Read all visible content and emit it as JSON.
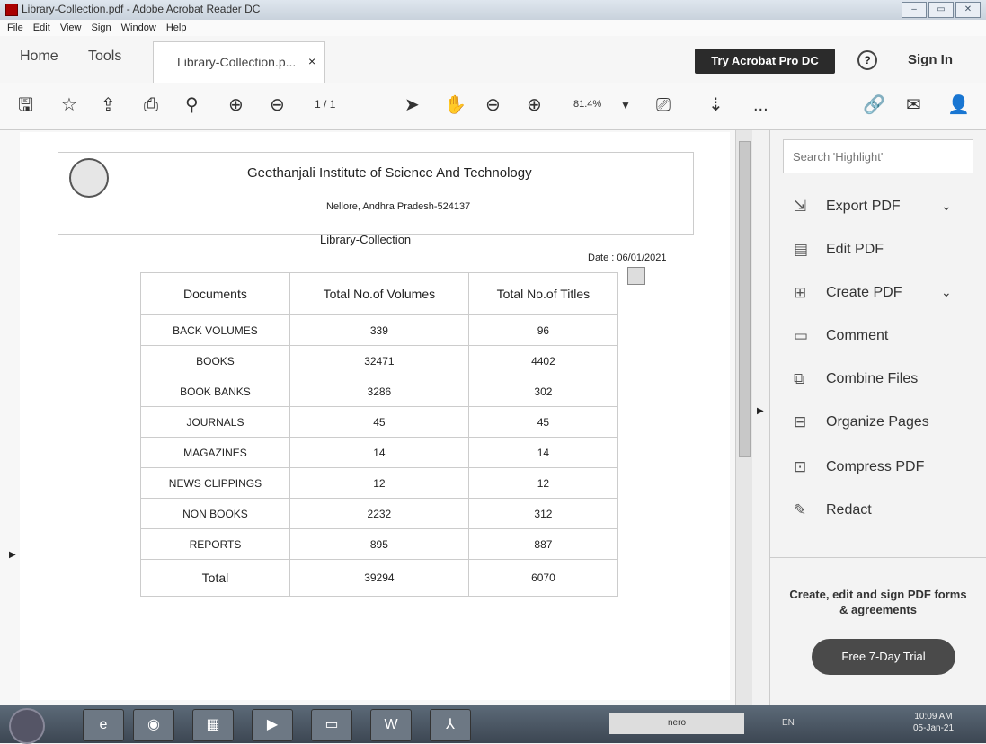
{
  "window": {
    "title": "Library-Collection.pdf - Adobe Acrobat Reader DC",
    "controls": [
      "–",
      "▭",
      "✕"
    ]
  },
  "menu": [
    "File",
    "Edit",
    "View",
    "Sign",
    "Window",
    "Help"
  ],
  "tabs": {
    "home": "Home",
    "tools": "Tools",
    "document": "Library-Collection.p...",
    "close": "×"
  },
  "header_right": {
    "try_button": "Try Acrobat Pro DC",
    "help": "?",
    "sign_in": "Sign In"
  },
  "toolbar": {
    "page_current": "1",
    "page_sep": "/",
    "page_total": "1",
    "zoom": "81.4%",
    "more": "..."
  },
  "document": {
    "institute": "Geethanjali Institute of Science And Technology",
    "location": "Nellore, Andhra Pradesh-524137",
    "collection_title": "Library-Collection",
    "date_label": "Date :",
    "date_value": "06/01/2021",
    "table": {
      "headers": [
        "Documents",
        "Total No.of Volumes",
        "Total No.of Titles"
      ],
      "rows": [
        [
          "BACK VOLUMES",
          "339",
          "96"
        ],
        [
          "BOOKS",
          "32471",
          "4402"
        ],
        [
          "BOOK BANKS",
          "3286",
          "302"
        ],
        [
          "JOURNALS",
          "45",
          "45"
        ],
        [
          "MAGAZINES",
          "14",
          "14"
        ],
        [
          "NEWS CLIPPINGS",
          "12",
          "12"
        ],
        [
          "NON BOOKS",
          "2232",
          "312"
        ],
        [
          "REPORTS",
          "895",
          "887"
        ]
      ],
      "total": [
        "Total",
        "39294",
        "6070"
      ]
    }
  },
  "right_panel": {
    "search_placeholder": "Search 'Highlight'",
    "tools": [
      "Export PDF",
      "Edit PDF",
      "Create PDF",
      "Comment",
      "Combine Files",
      "Organize Pages",
      "Compress PDF",
      "Redact"
    ],
    "promo_text": "Create, edit and sign PDF forms & agreements",
    "trial_button": "Free 7-Day Trial"
  },
  "taskbar": {
    "nero": "nero",
    "lang": "EN",
    "time": "10:09 AM",
    "date": "05-Jan-21"
  }
}
